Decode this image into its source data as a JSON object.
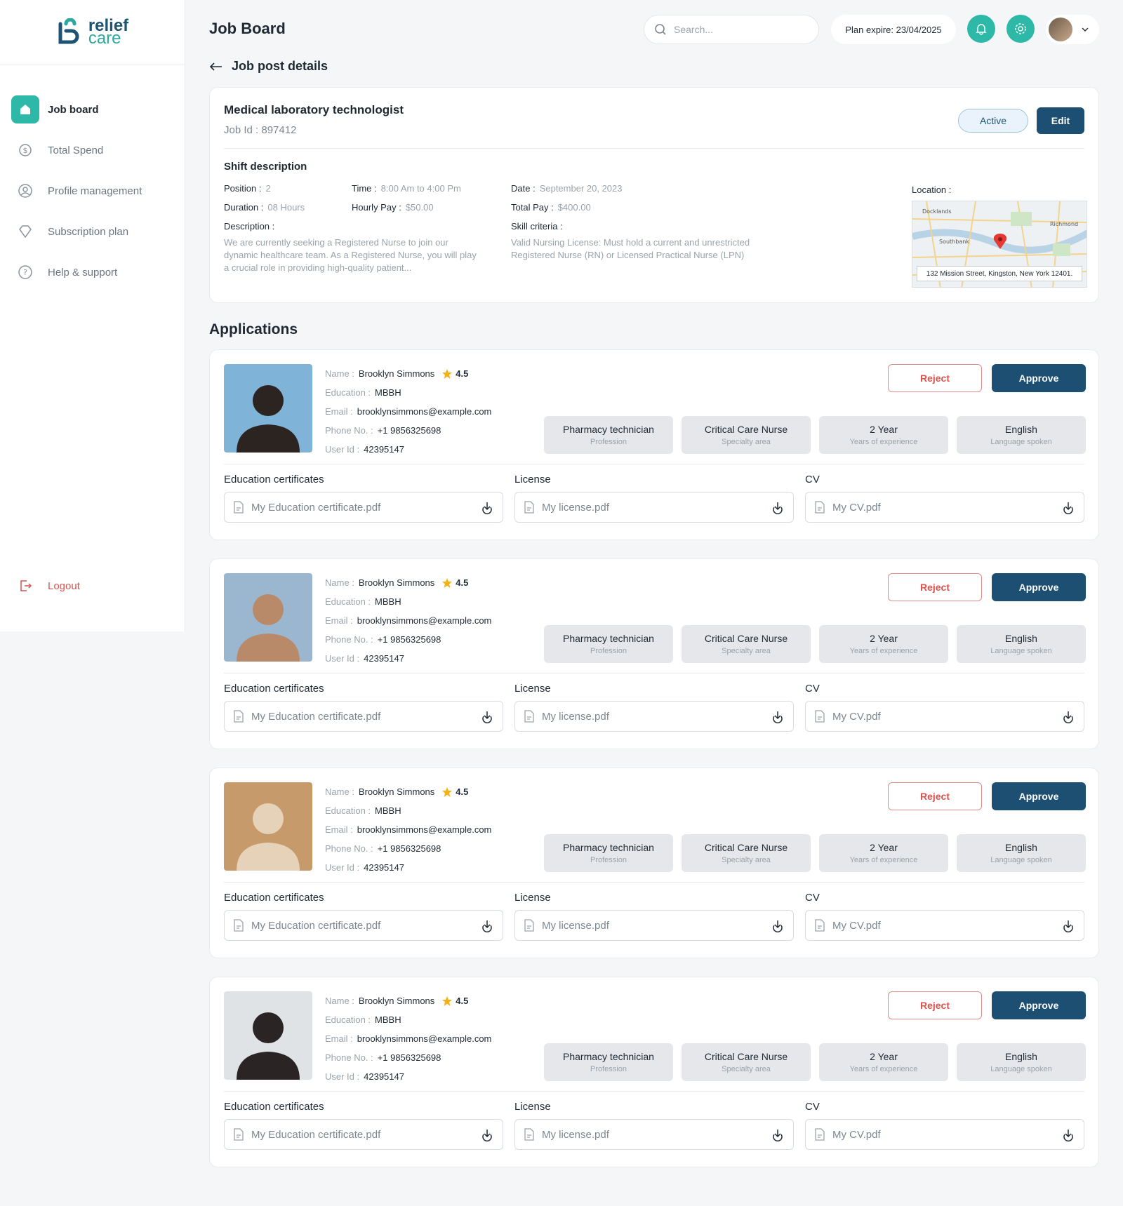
{
  "brand": {
    "line1": "relief",
    "line2": "care"
  },
  "sidebar": {
    "items": [
      {
        "label": "Job board",
        "icon": "home-icon",
        "active": true
      },
      {
        "label": "Total Spend",
        "icon": "dollar-icon"
      },
      {
        "label": "Profile management",
        "icon": "user-circle-icon"
      },
      {
        "label": "Subscription plan",
        "icon": "diamond-icon"
      },
      {
        "label": "Help & support",
        "icon": "help-icon"
      }
    ],
    "logout": "Logout"
  },
  "header": {
    "title": "Job Board",
    "search_placeholder": "Search...",
    "plan": "Plan expire: 23/04/2025"
  },
  "back_label": "Job post details",
  "job": {
    "title": "Medical laboratory technologist",
    "id": "Job Id : 897412",
    "status": "Active",
    "edit": "Edit",
    "shift_heading": "Shift description",
    "position_k": "Position :",
    "position_v": "2",
    "time_k": "Time :",
    "time_v": "8:00 Am to 4:00 Pm",
    "date_k": "Date :",
    "date_v": "September 20, 2023",
    "duration_k": "Duration :",
    "duration_v": "08 Hours",
    "hourly_k": "Hourly Pay :",
    "hourly_v": "$50.00",
    "total_k": "Total Pay :",
    "total_v": "$400.00",
    "description_k": "Description :",
    "description_v": "We are currently seeking a Registered Nurse to join our dynamic healthcare team. As a Registered Nurse, you will play a crucial role in providing high-quality patient...",
    "skill_k": "Skill criteria :",
    "skill_v": "Valid Nursing License: Must hold a current and unrestricted Registered Nurse (RN) or Licensed Practical Nurse (LPN)",
    "location_k": "Location :",
    "map_labels": [
      "Docklands",
      "Richmond",
      "Southbank"
    ],
    "address": "132 Mission Street, Kingston, New York 12401."
  },
  "applications_title": "Applications",
  "labels": {
    "name": "Name :",
    "education": "Education :",
    "email": "Email :",
    "phone": "Phone No. :",
    "user_id": "User Id :",
    "reject": "Reject",
    "approve": "Approve",
    "edu_cert": "Education certificates",
    "license": "License",
    "cv": "CV"
  },
  "applicants": [
    {
      "name": "Brooklyn Simmons",
      "rating": "4.5",
      "education": "MBBH",
      "email": "brooklynsimmons@example.com",
      "phone": "+1 9856325698",
      "user_id": "42395147",
      "chips": [
        {
          "t": "Pharmacy technician",
          "s": "Profession"
        },
        {
          "t": "Critical Care Nurse",
          "s": "Specialty area"
        },
        {
          "t": "2 Year",
          "s": "Years of experience"
        },
        {
          "t": "English",
          "s": "Language spoken"
        }
      ],
      "files": [
        "My Education certificate.pdf",
        "My license.pdf",
        "My CV.pdf"
      ],
      "photo_colors": [
        "#7fb3d8",
        "#2c2420"
      ]
    },
    {
      "name": "Brooklyn Simmons",
      "rating": "4.5",
      "education": "MBBH",
      "email": "brooklynsimmons@example.com",
      "phone": "+1 9856325698",
      "user_id": "42395147",
      "chips": [
        {
          "t": "Pharmacy technician",
          "s": "Profession"
        },
        {
          "t": "Critical Care Nurse",
          "s": "Specialty area"
        },
        {
          "t": "2 Year",
          "s": "Years of experience"
        },
        {
          "t": "English",
          "s": "Language spoken"
        }
      ],
      "files": [
        "My Education certificate.pdf",
        "My license.pdf",
        "My CV.pdf"
      ],
      "photo_colors": [
        "#9bb7cf",
        "#b98a6a"
      ]
    },
    {
      "name": "Brooklyn Simmons",
      "rating": "4.5",
      "education": "MBBH",
      "email": "brooklynsimmons@example.com",
      "phone": "+1 9856325698",
      "user_id": "42395147",
      "chips": [
        {
          "t": "Pharmacy technician",
          "s": "Profession"
        },
        {
          "t": "Critical Care Nurse",
          "s": "Specialty area"
        },
        {
          "t": "2 Year",
          "s": "Years of experience"
        },
        {
          "t": "English",
          "s": "Language spoken"
        }
      ],
      "files": [
        "My Education certificate.pdf",
        "My license.pdf",
        "My CV.pdf"
      ],
      "photo_colors": [
        "#c79a6b",
        "#e6d2b8"
      ]
    },
    {
      "name": "Brooklyn Simmons",
      "rating": "4.5",
      "education": "MBBH",
      "email": "brooklynsimmons@example.com",
      "phone": "+1 9856325698",
      "user_id": "42395147",
      "chips": [
        {
          "t": "Pharmacy technician",
          "s": "Profession"
        },
        {
          "t": "Critical Care Nurse",
          "s": "Specialty area"
        },
        {
          "t": "2 Year",
          "s": "Years of experience"
        },
        {
          "t": "English",
          "s": "Language spoken"
        }
      ],
      "files": [
        "My Education certificate.pdf",
        "My license.pdf",
        "My CV.pdf"
      ],
      "photo_colors": [
        "#dfe3e6",
        "#2a2524"
      ]
    }
  ],
  "colors": {
    "accent": "#2eb8a8",
    "primary": "#1d4f73",
    "danger": "#d9534f"
  }
}
